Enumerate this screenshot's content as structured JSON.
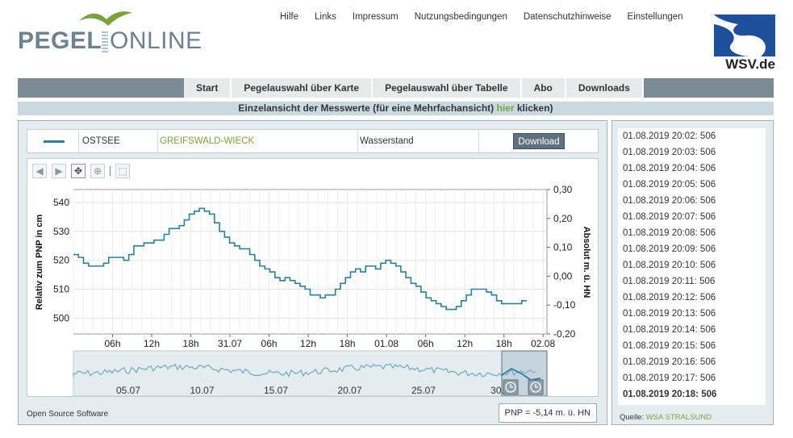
{
  "header": {
    "logo_pegel": "PEGEL",
    "logo_online": "ONLINE",
    "nav": [
      "Hilfe",
      "Links",
      "Impressum",
      "Nutzungsbedingungen",
      "Datenschutzhinweise",
      "Einstellungen"
    ],
    "wsv_label": "WSV.de"
  },
  "mainnav": {
    "tabs": [
      "Start",
      "Pegelauswahl über Karte",
      "Pegelauswahl über Tabelle",
      "Abo",
      "Downloads"
    ]
  },
  "banner": {
    "before": "Einzelansicht der Messwerte (für eine Mehrfachansicht) ",
    "link": "hier",
    "after": " klicken)"
  },
  "station": {
    "water": "OSTSEE",
    "name": "GREIFSWALD-WIECK",
    "parameter": "Wasserstand",
    "download_label": "Download"
  },
  "chart_data": {
    "type": "line",
    "ylabel": "Relativ zum PNP in cm",
    "y2label": "Absolut m. ü. HN",
    "yticks": [
      500,
      510,
      520,
      530,
      540
    ],
    "y2ticks": [
      "0,30",
      "0,20",
      "0,10",
      "0,00",
      "-0,10",
      "-0,20"
    ],
    "ylim": [
      494.5,
      544.5
    ],
    "xticks": [
      "06h",
      "12h",
      "18h",
      "31.07",
      "06h",
      "12h",
      "18h",
      "01.08",
      "06h",
      "12h",
      "18h",
      "02.08"
    ],
    "grid": true,
    "line_color": "#2b7fa1",
    "series": [
      {
        "values": [
          [
            0,
            522
          ],
          [
            1,
            521
          ],
          [
            2,
            519
          ],
          [
            3,
            518
          ],
          [
            5,
            518
          ],
          [
            6,
            519
          ],
          [
            7,
            521
          ],
          [
            9,
            521
          ],
          [
            10,
            520
          ],
          [
            11,
            522
          ],
          [
            12,
            525
          ],
          [
            14,
            526
          ],
          [
            16,
            527
          ],
          [
            18,
            529
          ],
          [
            19,
            531
          ],
          [
            21,
            532
          ],
          [
            22,
            534
          ],
          [
            23,
            536
          ],
          [
            24,
            537
          ],
          [
            25,
            538
          ],
          [
            26,
            537
          ],
          [
            27,
            536
          ],
          [
            28,
            533
          ],
          [
            29,
            530
          ],
          [
            30,
            528
          ],
          [
            31,
            526
          ],
          [
            32,
            525
          ],
          [
            33,
            524
          ],
          [
            34,
            524
          ],
          [
            35,
            522
          ],
          [
            36,
            520
          ],
          [
            37,
            518
          ],
          [
            38,
            517
          ],
          [
            39,
            516
          ],
          [
            40,
            514
          ],
          [
            41,
            513
          ],
          [
            42,
            514
          ],
          [
            43,
            513
          ],
          [
            44,
            512
          ],
          [
            45,
            511
          ],
          [
            46,
            510
          ],
          [
            47,
            508
          ],
          [
            48,
            508
          ],
          [
            49,
            507
          ],
          [
            50,
            508
          ],
          [
            51,
            508
          ],
          [
            52,
            510
          ],
          [
            53,
            512
          ],
          [
            54,
            514
          ],
          [
            55,
            516
          ],
          [
            56,
            517
          ],
          [
            57,
            516
          ],
          [
            58,
            518
          ],
          [
            59,
            518
          ],
          [
            60,
            517
          ],
          [
            61,
            519
          ],
          [
            62,
            520
          ],
          [
            63,
            519
          ],
          [
            64,
            518
          ],
          [
            65,
            516
          ],
          [
            66,
            514
          ],
          [
            67,
            512
          ],
          [
            68,
            511
          ],
          [
            69,
            509
          ],
          [
            70,
            507
          ],
          [
            71,
            506
          ],
          [
            72,
            505
          ],
          [
            73,
            504
          ],
          [
            74,
            503
          ],
          [
            75,
            503
          ],
          [
            76,
            504
          ],
          [
            77,
            506
          ],
          [
            78,
            508
          ],
          [
            79,
            510
          ],
          [
            80,
            510
          ],
          [
            81,
            510
          ],
          [
            82,
            509
          ],
          [
            83,
            508
          ],
          [
            84,
            506
          ],
          [
            85,
            505
          ],
          [
            86,
            505
          ],
          [
            87,
            505
          ],
          [
            88,
            505
          ],
          [
            89,
            506
          ],
          [
            90,
            506
          ]
        ]
      }
    ]
  },
  "overview": {
    "ticks": [
      "05.07",
      "10.07",
      "15.07",
      "20.07",
      "25.07",
      "30."
    ]
  },
  "tools": [
    "arrow-left-icon",
    "arrow-right-icon",
    "pan-icon",
    "zoom-icon",
    "zoom-box-icon"
  ],
  "open_source": "Open Source Software",
  "pnp": "PNP = -5,14 m. ü. HN",
  "readings": [
    "01.08.2019 20:02: 506",
    "01.08.2019 20:03: 506",
    "01.08.2019 20:04: 506",
    "01.08.2019 20:05: 506",
    "01.08.2019 20:06: 506",
    "01.08.2019 20:07: 506",
    "01.08.2019 20:08: 506",
    "01.08.2019 20:09: 506",
    "01.08.2019 20:10: 506",
    "01.08.2019 20:11: 506",
    "01.08.2019 20:12: 506",
    "01.08.2019 20:13: 506",
    "01.08.2019 20:14: 506",
    "01.08.2019 20:15: 506",
    "01.08.2019 20:16: 506",
    "01.08.2019 20:17: 506",
    "01.08.2019 20:18: 506"
  ],
  "source": {
    "label": "Quelle: ",
    "value": "WSA STRALSUND"
  }
}
